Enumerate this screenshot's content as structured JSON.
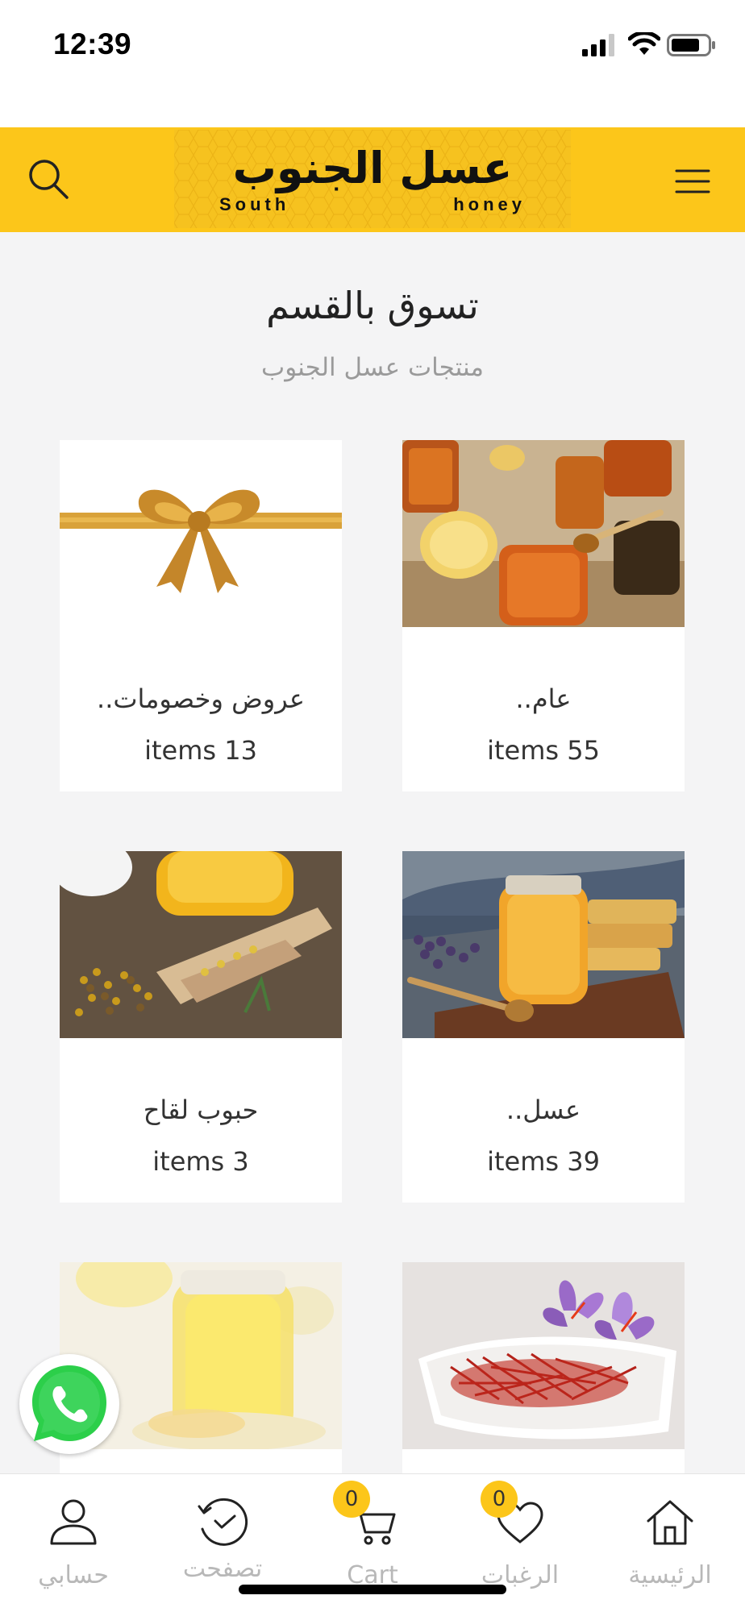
{
  "status_bar": {
    "time": "12:39"
  },
  "header": {
    "logo_text_ar": "عسل الجنوب",
    "logo_text_en_1": "South",
    "logo_text_en_2": "honey",
    "accent_color": "#fcc61a",
    "search_icon": "search-icon",
    "menu_icon": "hamburger-menu-icon"
  },
  "section": {
    "title": "تسوق بالقسم",
    "subtitle": "منتجات عسل الجنوب"
  },
  "categories": [
    {
      "name": "عام..",
      "count": "items 55",
      "image": "honey-jars-photo"
    },
    {
      "name": "عروض وخصومات..",
      "count": "items 13",
      "image": "gold-ribbon-bow-photo"
    },
    {
      "name": "عسل..",
      "count": "items 39",
      "image": "honey-jar-lavender-photo"
    },
    {
      "name": "حبوب لقاح",
      "count": "items 3",
      "image": "bee-pollen-scoop-photo"
    },
    {
      "image": "saffron-flowers-photo"
    },
    {
      "image": "lemon-honey-jar-photo"
    }
  ],
  "bottom_nav": {
    "items": [
      {
        "label": "الرئيسية",
        "icon": "home-icon"
      },
      {
        "label": "الرغبات",
        "icon": "heart-icon",
        "badge": "0"
      },
      {
        "label": "Cart",
        "icon": "cart-icon",
        "badge": "0"
      },
      {
        "label": "تصفحت",
        "icon": "history-clock-icon"
      },
      {
        "label": "حسابي",
        "icon": "user-icon"
      }
    ]
  },
  "whatsapp": {
    "icon": "whatsapp-icon"
  }
}
